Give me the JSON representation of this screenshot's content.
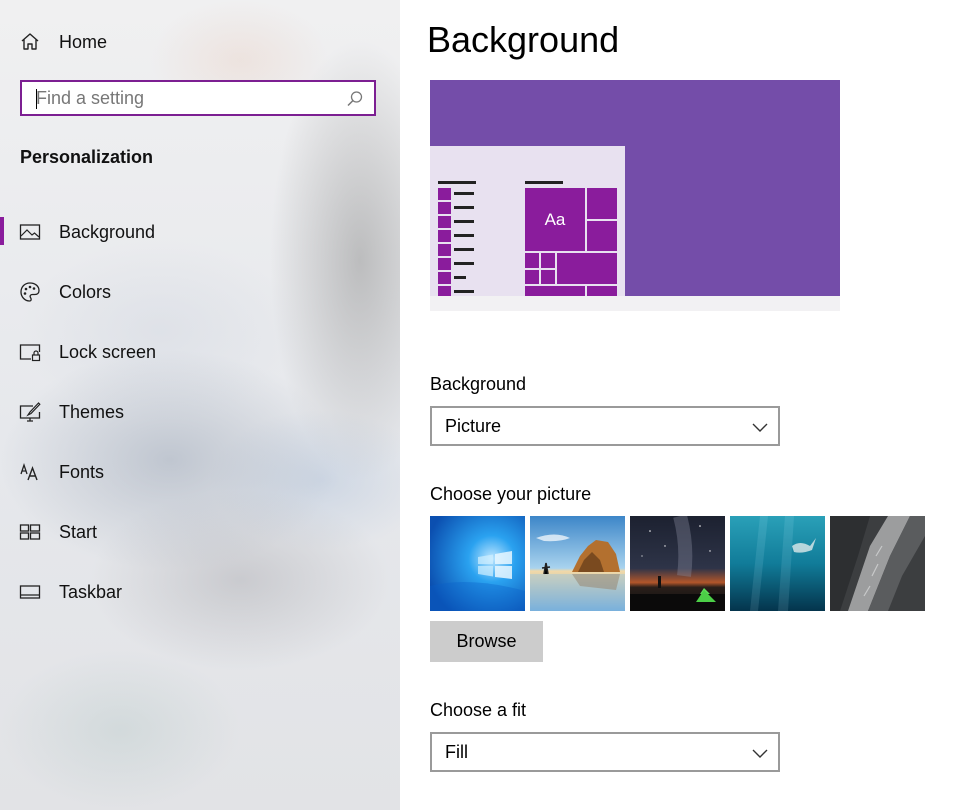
{
  "sidebar": {
    "home_label": "Home",
    "search": {
      "placeholder": "Find a setting",
      "value": ""
    },
    "section_heading": "Personalization",
    "items": [
      {
        "label": "Background",
        "icon": "picture-icon",
        "selected": true
      },
      {
        "label": "Colors",
        "icon": "palette-icon",
        "selected": false
      },
      {
        "label": "Lock screen",
        "icon": "lock-screen-icon",
        "selected": false
      },
      {
        "label": "Themes",
        "icon": "themes-icon",
        "selected": false
      },
      {
        "label": "Fonts",
        "icon": "fonts-icon",
        "selected": false
      },
      {
        "label": "Start",
        "icon": "start-icon",
        "selected": false
      },
      {
        "label": "Taskbar",
        "icon": "taskbar-icon",
        "selected": false
      }
    ]
  },
  "main": {
    "title": "Background",
    "preview": {
      "sample_text": "Aa",
      "accent_color": "#8a1c9c",
      "background_color": "#744da9"
    },
    "background_field": {
      "label": "Background",
      "value": "Picture"
    },
    "picture_field": {
      "label": "Choose your picture",
      "thumbnails": [
        "windows-logo-wallpaper",
        "beach-rock-wallpaper",
        "night-sky-tent-wallpaper",
        "underwater-swimmer-wallpaper",
        "rock-cliff-wallpaper"
      ],
      "browse_label": "Browse"
    },
    "fit_field": {
      "label": "Choose a fit",
      "value": "Fill"
    }
  },
  "colors": {
    "accent": "#8a1c9c",
    "search_border": "#7c1f92"
  }
}
